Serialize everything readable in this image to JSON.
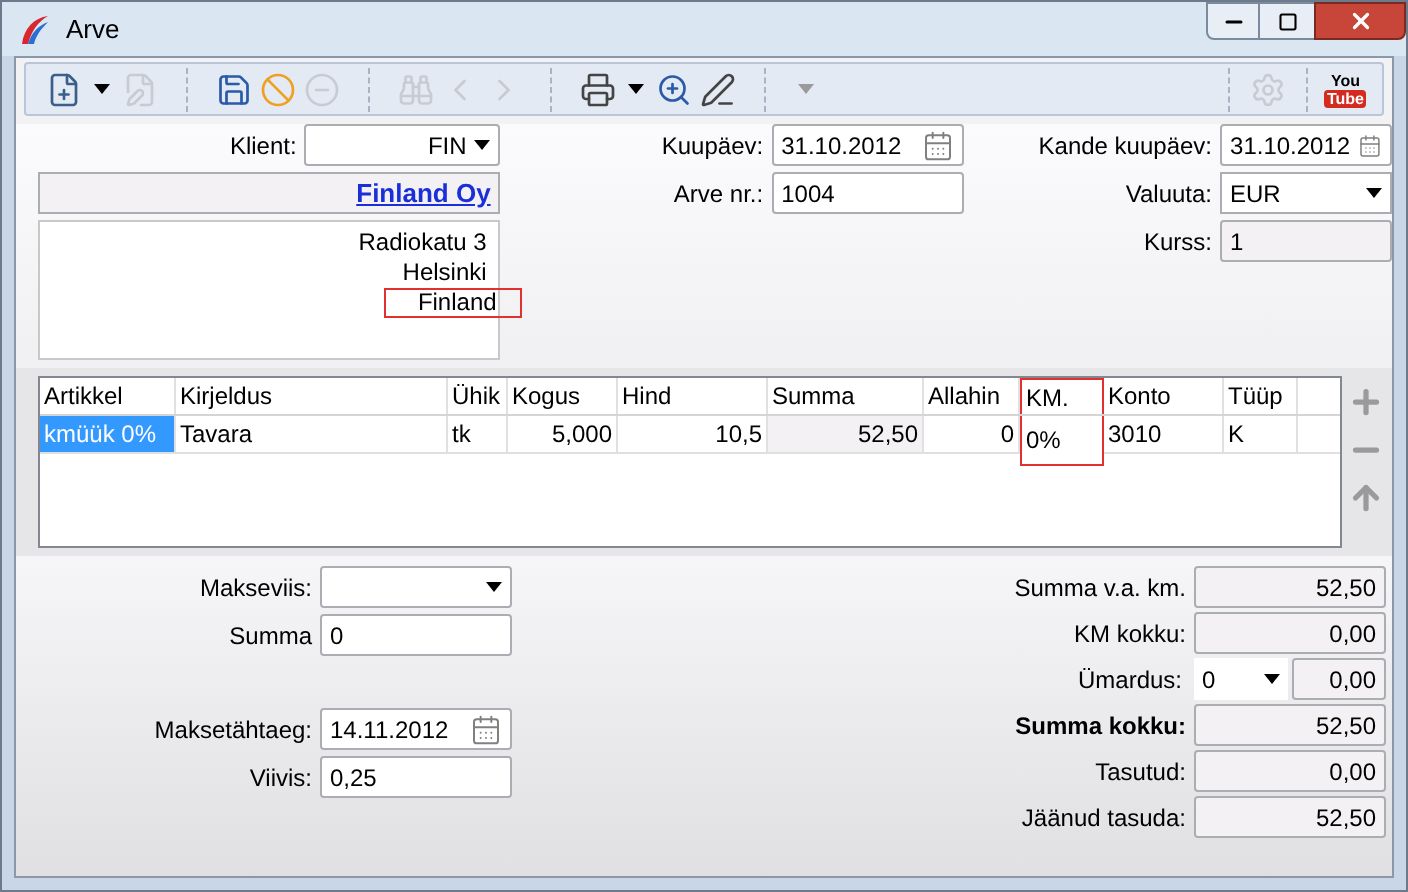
{
  "window": {
    "title": "Arve"
  },
  "toolbar": {
    "groups": [
      [
        {
          "kind": "new",
          "disabled": false
        },
        {
          "kind": "caret",
          "disabled": false
        },
        {
          "kind": "edit",
          "disabled": true
        }
      ],
      [
        {
          "kind": "save",
          "disabled": false
        },
        {
          "kind": "cancel",
          "disabled": false
        },
        {
          "kind": "remove",
          "disabled": true
        }
      ],
      [
        {
          "kind": "find",
          "disabled": true
        },
        {
          "kind": "prev",
          "disabled": true
        },
        {
          "kind": "next",
          "disabled": true
        }
      ],
      [
        {
          "kind": "print",
          "disabled": false
        },
        {
          "kind": "caret",
          "disabled": false
        },
        {
          "kind": "preview",
          "disabled": false
        },
        {
          "kind": "sign",
          "disabled": false
        }
      ],
      [
        {
          "kind": "caret",
          "disabled": true
        }
      ]
    ],
    "right": [
      {
        "kind": "gear",
        "disabled": true
      }
    ],
    "logo_text": [
      "You",
      "Tube"
    ]
  },
  "header": {
    "client": {
      "label": "Klient:",
      "value": "FIN"
    },
    "client_name": "Finland Oy",
    "address": [
      {
        "text": "Radiokatu 3",
        "highlighted": false
      },
      {
        "text": "Helsinki",
        "highlighted": false
      },
      {
        "text": "Finland",
        "highlighted": true
      }
    ],
    "invoice_date": {
      "label": "Kuupäev:",
      "value": "31.10.2012"
    },
    "invoice_no": {
      "label": "Arve nr.:",
      "value": "1004"
    },
    "entry_date": {
      "label": "Kande kuupäev:",
      "value": "31.10.2012"
    },
    "currency": {
      "label": "Valuuta:",
      "value": "EUR"
    },
    "rate": {
      "label": "Kurss:",
      "value": "1"
    }
  },
  "table": {
    "columns": [
      {
        "label": "Artikkel",
        "readonly": false,
        "highlighted": false
      },
      {
        "label": "Kirjeldus",
        "readonly": false,
        "highlighted": false
      },
      {
        "label": "Ühik",
        "readonly": false,
        "highlighted": false
      },
      {
        "label": "Kogus",
        "readonly": false,
        "highlighted": false
      },
      {
        "label": "Hind",
        "readonly": false,
        "highlighted": false
      },
      {
        "label": "Summa",
        "readonly": true,
        "highlighted": false
      },
      {
        "label": "Allahin",
        "readonly": false,
        "highlighted": false
      },
      {
        "label": "KM.",
        "readonly": false,
        "highlighted": true
      },
      {
        "label": "Konto",
        "readonly": false,
        "highlighted": false
      },
      {
        "label": "Tüüp",
        "readonly": false,
        "highlighted": false
      }
    ],
    "rows": [
      {
        "cells": [
          {
            "text": "kmüük 0%",
            "selected": true
          },
          {
            "text": "Tavara",
            "selected": false
          },
          {
            "text": "tk",
            "selected": false
          },
          {
            "text": "5,000",
            "selected": false
          },
          {
            "text": "10,5",
            "selected": false
          },
          {
            "text": "52,50",
            "selected": false
          },
          {
            "text": "0",
            "selected": false
          },
          {
            "text": "0%",
            "selected": false
          },
          {
            "text": "3010",
            "selected": false
          },
          {
            "text": "K",
            "selected": false
          }
        ]
      }
    ]
  },
  "payment": {
    "method": {
      "label": "Makseviis:"
    },
    "amount": {
      "label": "Summa",
      "value": "0"
    },
    "due_date": {
      "label": "Maksetähtaeg:",
      "value": "14.11.2012"
    },
    "penalty": {
      "label": "Viivis:",
      "value": "0,25"
    }
  },
  "totals": [
    {
      "kind": "field",
      "label": "Summa v.a. km.",
      "value": "52,50",
      "bold": false
    },
    {
      "kind": "field",
      "label": "KM kokku:",
      "value": "0,00",
      "bold": false
    },
    {
      "kind": "rounding",
      "label": "Ümardus:",
      "option": "0",
      "value": "0,00",
      "bold": false
    },
    {
      "kind": "field",
      "label": "Summa kokku:",
      "value": "52,50",
      "bold": true
    },
    {
      "kind": "field",
      "label": "Tasutud:",
      "value": "0,00",
      "bold": false
    },
    {
      "kind": "field",
      "label": "Jäänud tasuda:",
      "value": "52,50",
      "bold": false
    }
  ]
}
